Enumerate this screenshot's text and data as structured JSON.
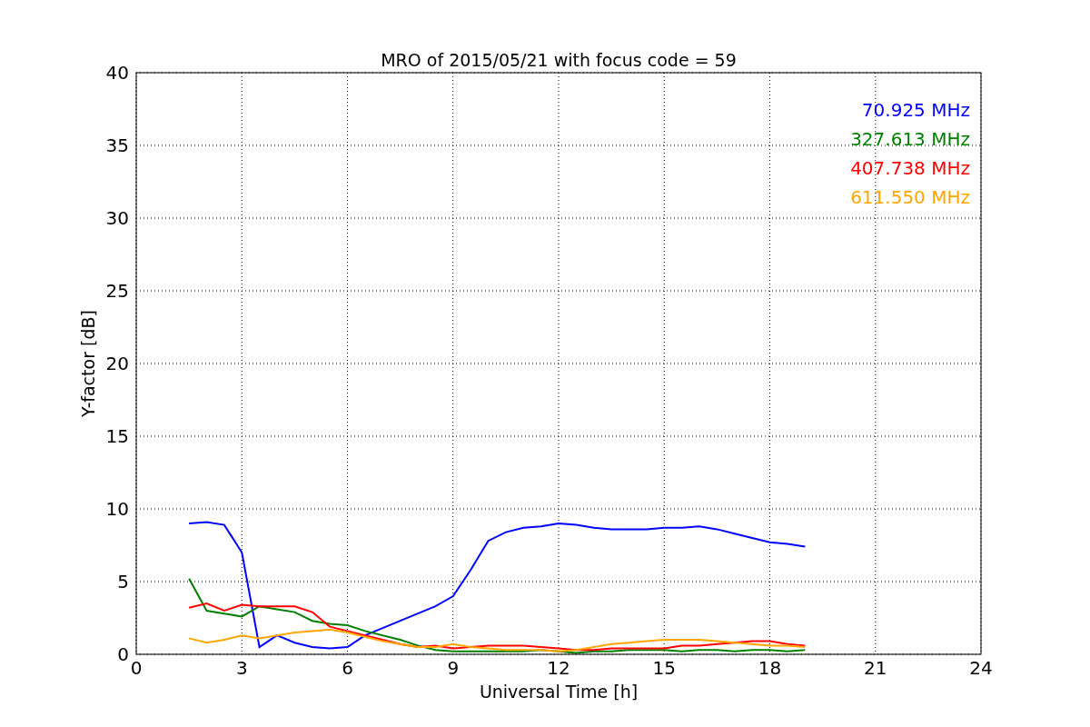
{
  "chart_data": {
    "type": "line",
    "title": "MRO of 2015/05/21 with focus code = 59",
    "xlabel": "Universal Time [h]",
    "ylabel": "Y-factor [dB]",
    "x": [
      1.5,
      2,
      2.5,
      3,
      3.5,
      4,
      4.5,
      5,
      5.5,
      6,
      6.5,
      7,
      7.5,
      8,
      8.5,
      9,
      9.5,
      10,
      10.5,
      11,
      11.5,
      12,
      12.5,
      13,
      13.5,
      14,
      14.5,
      15,
      15.5,
      16,
      16.5,
      17,
      17.5,
      18,
      18.5,
      19
    ],
    "series": [
      {
        "name": "70.925 MHz",
        "color": "#0000ff",
        "values": [
          9,
          9.1,
          8.9,
          7,
          0.5,
          1.3,
          0.8,
          0.5,
          0.4,
          0.5,
          1.3,
          1.8,
          2.3,
          2.8,
          3.3,
          4,
          5.8,
          7.8,
          8.4,
          8.7,
          8.8,
          9,
          8.9,
          8.7,
          8.6,
          8.6,
          8.6,
          8.7,
          8.7,
          8.8,
          8.6,
          8.3,
          8.0,
          7.7,
          7.6,
          7.4
        ]
      },
      {
        "name": "327.613 MHz",
        "color": "#008000",
        "values": [
          5.2,
          3,
          2.8,
          2.6,
          3.3,
          3.1,
          2.9,
          2.3,
          2.1,
          2.0,
          1.6,
          1.3,
          1.0,
          0.6,
          0.3,
          0.2,
          0.2,
          0.2,
          0.2,
          0.2,
          0.3,
          0.2,
          0.1,
          0.2,
          0.2,
          0.3,
          0.3,
          0.3,
          0.2,
          0.3,
          0.3,
          0.2,
          0.3,
          0.3,
          0.2,
          0.3
        ]
      },
      {
        "name": "407.738 MHz",
        "color": "#ff0000",
        "values": [
          3.2,
          3.5,
          3.0,
          3.4,
          3.3,
          3.3,
          3.3,
          2.9,
          1.9,
          1.6,
          1.3,
          1.0,
          0.7,
          0.5,
          0.6,
          0.4,
          0.5,
          0.6,
          0.6,
          0.6,
          0.5,
          0.4,
          0.3,
          0.3,
          0.4,
          0.4,
          0.4,
          0.4,
          0.6,
          0.6,
          0.7,
          0.8,
          0.9,
          0.9,
          0.7,
          0.6
        ]
      },
      {
        "name": "611.550 MHz",
        "color": "#ffa500",
        "values": [
          1.1,
          0.8,
          1.0,
          1.3,
          1.1,
          1.3,
          1.5,
          1.6,
          1.7,
          1.5,
          1.2,
          0.9,
          0.7,
          0.5,
          0.5,
          0.7,
          0.5,
          0.4,
          0.3,
          0.3,
          0.3,
          0.2,
          0.3,
          0.5,
          0.7,
          0.8,
          0.9,
          1.0,
          1.0,
          1.0,
          0.9,
          0.8,
          0.7,
          0.6,
          0.6,
          0.5
        ]
      }
    ],
    "xlim": [
      0,
      24
    ],
    "ylim": [
      0,
      40
    ],
    "xticks": [
      0,
      3,
      6,
      9,
      12,
      15,
      18,
      21,
      24
    ],
    "yticks": [
      0,
      5,
      10,
      15,
      20,
      25,
      30,
      35,
      40
    ],
    "grid": true
  }
}
